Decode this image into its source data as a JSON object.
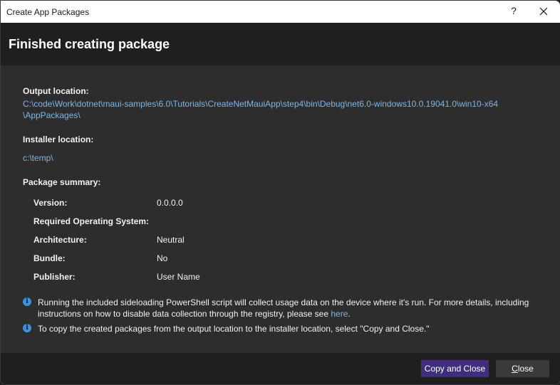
{
  "window": {
    "title": "Create App Packages",
    "help_label": "?",
    "close_icon": "close-icon"
  },
  "header": {
    "title": "Finished creating package"
  },
  "output_location": {
    "label": "Output location:",
    "path_line1": "C:\\code\\Work\\dotnet\\maui-samples\\6.0\\Tutorials\\CreateNetMauiApp\\step4\\bin\\Debug\\net6.0-windows10.0.19041.0\\win10-x64",
    "path_line2": "\\AppPackages\\"
  },
  "installer_location": {
    "label": "Installer location:",
    "path": "c:\\temp\\"
  },
  "package_summary": {
    "label": "Package summary:",
    "rows": [
      {
        "label": "Version:",
        "value": "0.0.0.0"
      },
      {
        "label": "Required Operating System:",
        "value": ""
      },
      {
        "label": "Architecture:",
        "value": "Neutral"
      },
      {
        "label": "Bundle:",
        "value": "No"
      },
      {
        "label": "Publisher:",
        "value": "User Name"
      }
    ]
  },
  "info": [
    {
      "icon": "info-icon",
      "line1": "Running the included sideloading PowerShell script will collect usage data on the device where it's run.  For more details, including",
      "line2": "instructions on how to disable data collection through the registry, please see ",
      "link": "here",
      "after_link": "."
    },
    {
      "icon": "info-icon",
      "line1": "To copy the created packages from the output location to the installer location, select \"Copy and Close.\""
    }
  ],
  "buttons": {
    "copy_and_close": "Copy and Close",
    "close_mnemonic": "C",
    "close_rest": "lose"
  },
  "colors": {
    "accent_button": "#3e2e7d",
    "link": "#7eb6e6",
    "info_icon": "#3794e4"
  }
}
